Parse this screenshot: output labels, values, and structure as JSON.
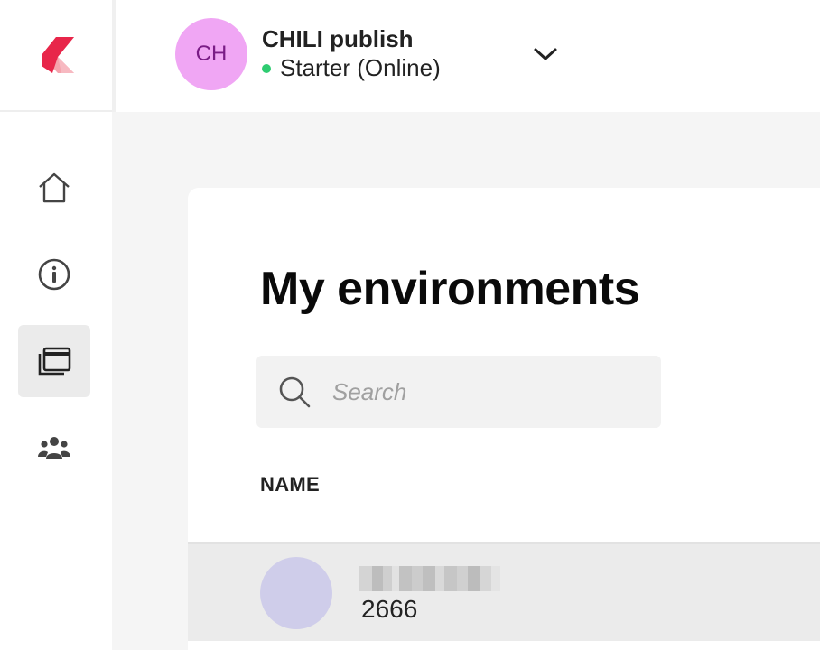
{
  "org": {
    "initials": "CH",
    "name": "CHILI publish",
    "status": "Starter (Online)",
    "status_color": "#2ecc71",
    "avatar_color": "#f0a6f4"
  },
  "nav": [
    {
      "icon": "home-icon",
      "active": false
    },
    {
      "icon": "info-icon",
      "active": false
    },
    {
      "icon": "environments-icon",
      "active": true
    },
    {
      "icon": "users-icon",
      "active": false
    }
  ],
  "main": {
    "title": "My environments",
    "search": {
      "placeholder": "Search",
      "value": ""
    },
    "columns": [
      "NAME"
    ],
    "rows": [
      {
        "id": "2666"
      }
    ]
  },
  "colors": {
    "brand_red": "#e8264a",
    "brand_pink": "#f5a3ad"
  }
}
